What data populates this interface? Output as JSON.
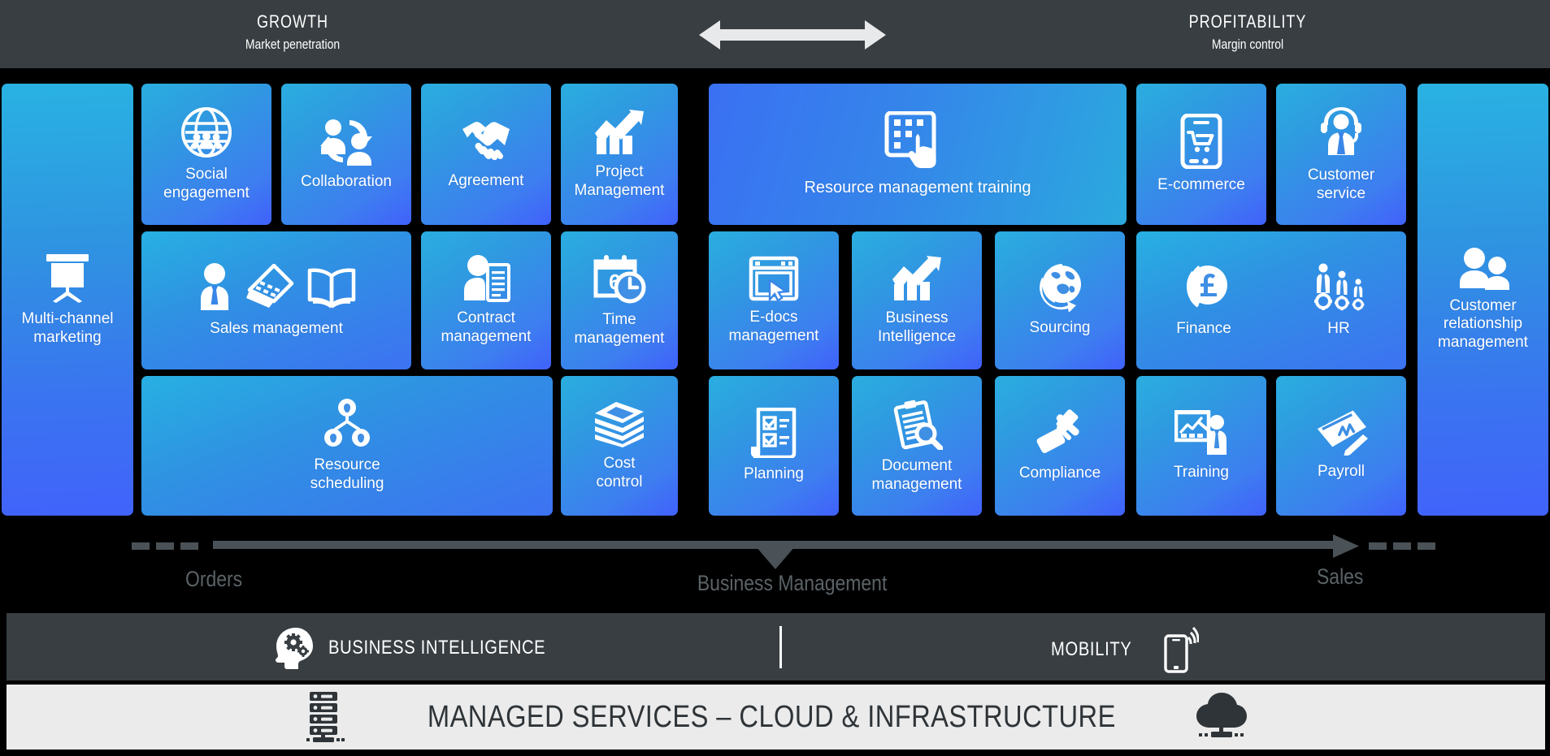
{
  "header": {
    "left": {
      "title": "GROWTH",
      "subtitle": "Market penetration"
    },
    "right": {
      "title": "PROFITABILITY",
      "subtitle": "Margin control"
    },
    "center_icon": "double-arrow-icon"
  },
  "tiles": {
    "multi_channel_marketing": {
      "label": "Multi-channel\nmarketing",
      "icon": "projector-screen-icon"
    },
    "social_engagement": {
      "label": "Social\nengagement",
      "icon": "globe-people-icon"
    },
    "collaboration": {
      "label": "Collaboration",
      "icon": "collaboration-people-icon"
    },
    "agreement": {
      "label": "Agreement",
      "icon": "handshake-icon"
    },
    "project_management": {
      "label": "Project\nManagement",
      "icon": "growth-chart-icon"
    },
    "resource_management_training": {
      "label": "Resource management training",
      "icon": "touch-tablet-icon"
    },
    "ecommerce": {
      "label": "E-commerce",
      "icon": "mobile-cart-icon"
    },
    "customer_service": {
      "label": "Customer\nservice",
      "icon": "headset-agent-icon"
    },
    "customer_relationship_management": {
      "label": "Customer\nrelationship\nmanagement",
      "icon": "two-people-icon"
    },
    "sales_management": {
      "label": "Sales management",
      "icons": [
        "salesperson-icon",
        "laptop-icon",
        "open-book-icon"
      ]
    },
    "contract_management": {
      "label": "Contract\nmanagement",
      "icon": "person-document-icon"
    },
    "time_management": {
      "label": "Time\nmanagement",
      "icon": "calendar-clock-icon"
    },
    "edocs_management": {
      "label": "E-docs\nmanagement",
      "icon": "browser-cursor-icon"
    },
    "business_intelligence_tile": {
      "label": "Business\nIntelligence",
      "icon": "growth-chart-icon"
    },
    "sourcing": {
      "label": "Sourcing",
      "icon": "globe-arrow-icon"
    },
    "finance": {
      "label": "Finance",
      "icon": "pound-coin-icon"
    },
    "hr": {
      "label": "HR",
      "icon": "people-gears-icon"
    },
    "resource_scheduling": {
      "label": "Resource\nscheduling",
      "icon": "org-chart-people-icon"
    },
    "cost_control": {
      "label": "Cost\ncontrol",
      "icon": "money-stack-icon"
    },
    "planning": {
      "label": "Planning",
      "icon": "checklist-icon"
    },
    "document_management": {
      "label": "Document\nmanagement",
      "icon": "clipboard-search-icon"
    },
    "compliance": {
      "label": "Compliance",
      "icon": "gavel-icon"
    },
    "training": {
      "label": "Training",
      "icon": "presenter-board-icon"
    },
    "payroll": {
      "label": "Payroll",
      "icon": "cheque-pen-icon"
    }
  },
  "axis": {
    "left_label": "Orders",
    "center_label": "Business Management",
    "right_label": "Sales"
  },
  "mid_bar": {
    "business_intelligence": {
      "label": "BUSINESS INTELLIGENCE",
      "icon": "head-gears-icon"
    },
    "mobility": {
      "label": "MOBILITY",
      "icon": "mobile-signal-icon"
    }
  },
  "bottom_bar": {
    "label": "MANAGED SERVICES – CLOUD & INFRASTRUCTURE",
    "left_icon": "server-rack-icon",
    "right_icon": "cloud-network-icon"
  },
  "colors": {
    "bar_dark": "#383e42",
    "bottom_light": "#ebebeb",
    "tile_cyan": "#2aaee0",
    "tile_blue": "#4161fb",
    "axis_grey": "#5b6367",
    "background": "#000000"
  }
}
